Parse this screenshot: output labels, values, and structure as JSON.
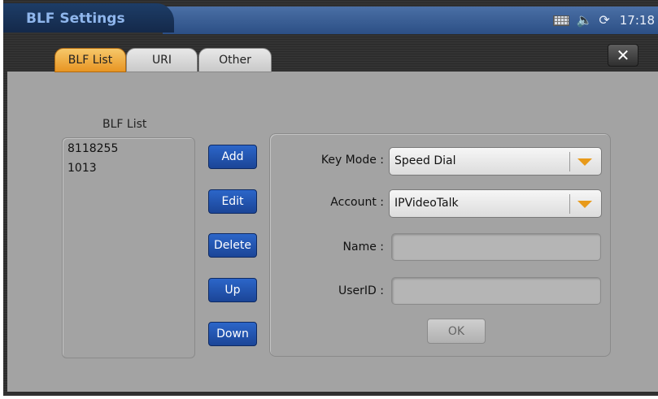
{
  "window": {
    "title": "BLF Settings"
  },
  "status_bar": {
    "clock": "17:18",
    "icons": [
      "keyboard-icon",
      "volume-icon",
      "sync-icon"
    ]
  },
  "tabs": [
    {
      "label": "BLF List",
      "active": true
    },
    {
      "label": "URI",
      "active": false
    },
    {
      "label": "Other",
      "active": false
    }
  ],
  "close": {
    "label": "✕"
  },
  "blf_list": {
    "title": "BLF List",
    "entries": [
      "8118255",
      "1013"
    ]
  },
  "actions": {
    "add": "Add",
    "edit": "Edit",
    "delete": "Delete",
    "up": "Up",
    "down": "Down"
  },
  "form": {
    "key_mode": {
      "label": "Key Mode :",
      "value": "Speed Dial"
    },
    "account": {
      "label": "Account :",
      "value": "IPVideoTalk"
    },
    "name": {
      "label": "Name :",
      "value": ""
    },
    "userid": {
      "label": "UserID :",
      "value": ""
    },
    "ok": "OK"
  },
  "colors": {
    "active_tab": "#f0a83a",
    "action_button": "#2356b0",
    "panel": "#a3a3a3",
    "title_bar": "#3a5f96",
    "dropdown_arrow": "#e89a1a"
  }
}
